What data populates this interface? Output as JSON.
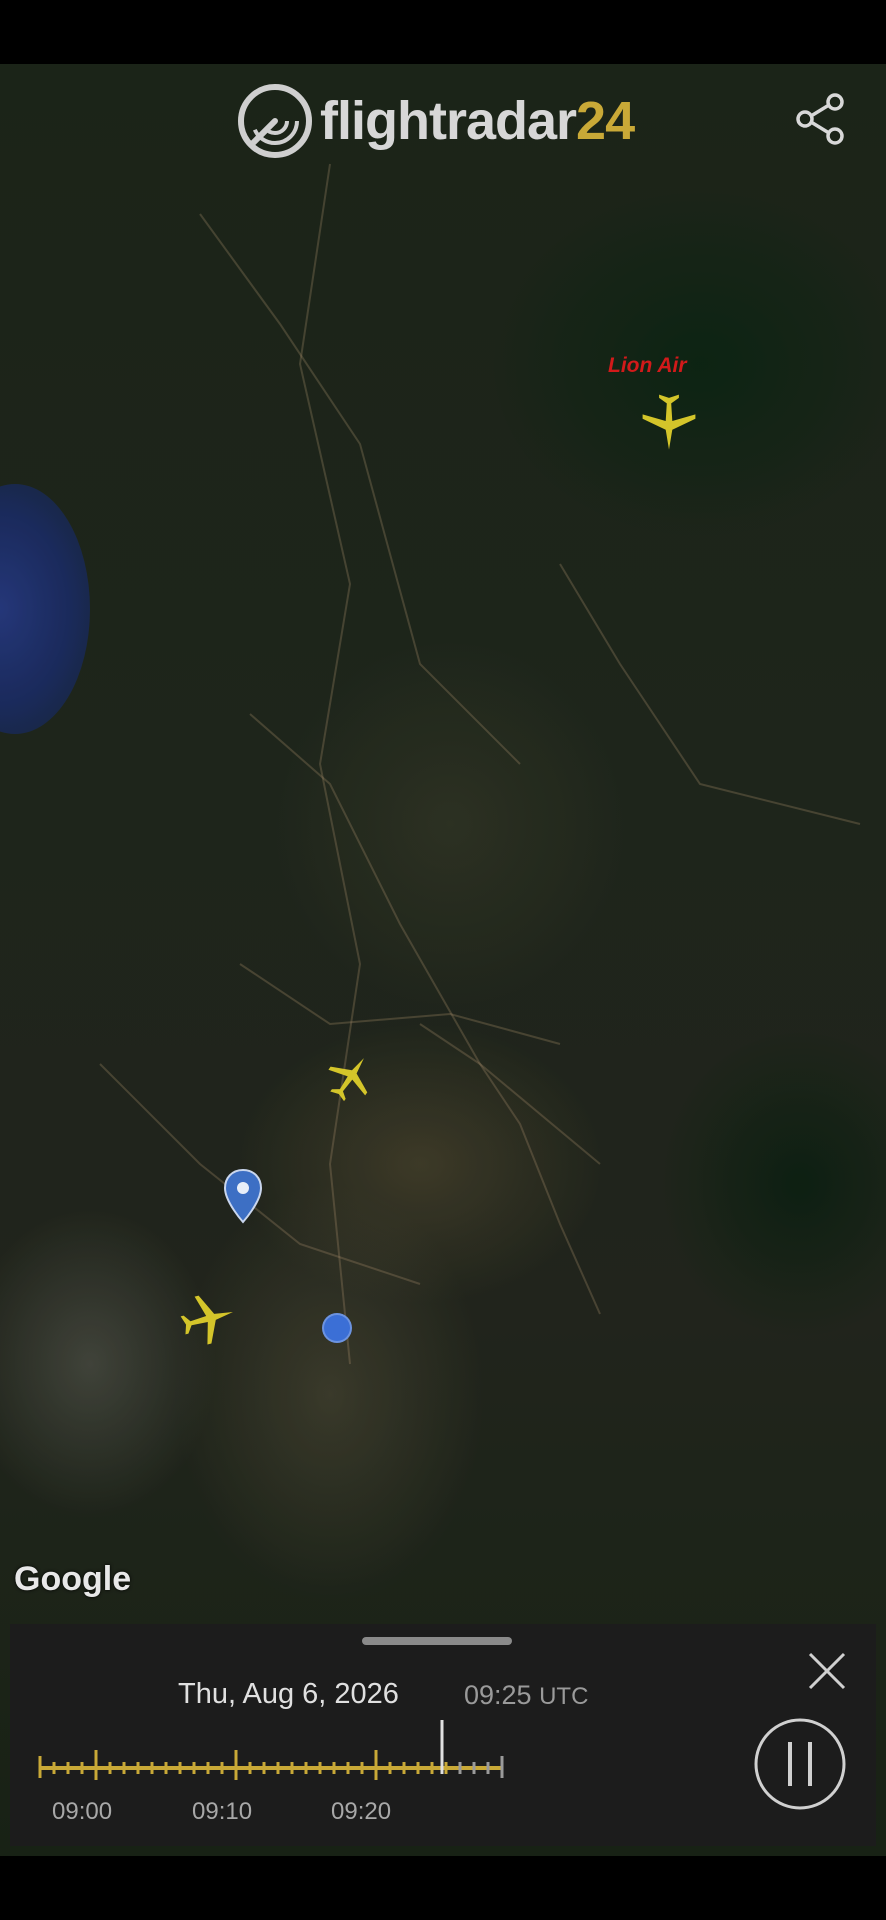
{
  "app": {
    "logo_text_main": "flightradar",
    "logo_text_num": "24",
    "accent_color": "#c9a937"
  },
  "icons": {
    "share": "share-icon",
    "close": "close-icon",
    "pause": "pause-icon",
    "location_pin": "location-pin-icon",
    "plane": "plane-icon"
  },
  "map": {
    "attribution": "Google",
    "airline_label": "Lion Air",
    "airline_label_color": "#d21a1a",
    "plane_color": "#d4c52a",
    "user_location_color": "#3b6fd6"
  },
  "playback": {
    "date": "Thu, Aug 6, 2026",
    "time": "09:25",
    "timezone": "UTC",
    "tick_labels": [
      "09:00",
      "09:10",
      "09:20"
    ],
    "timeline_color": "#c9a937"
  }
}
